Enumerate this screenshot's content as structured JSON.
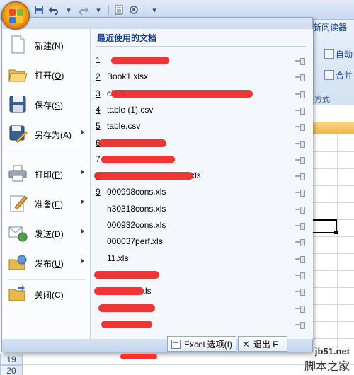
{
  "quick_access": {
    "items": [
      "save-icon",
      "undo-icon",
      "redo-icon",
      "print-preview-icon",
      "customize-icon"
    ]
  },
  "ribbon": {
    "tab_partial": "新阅读器",
    "autofill_partial": "自动",
    "merge_partial": "合并",
    "group_partial": "方式"
  },
  "grid": {
    "row_number": "19",
    "row_number_2": "20"
  },
  "menu": {
    "commands": [
      {
        "label": "新建",
        "hotkey": "N",
        "icon": "new-document-icon",
        "submenu": false
      },
      {
        "label": "打开",
        "hotkey": "O",
        "icon": "open-folder-icon",
        "submenu": false
      },
      {
        "label": "保存",
        "hotkey": "S",
        "icon": "save-disk-icon",
        "submenu": false
      },
      {
        "label": "另存为",
        "hotkey": "A",
        "icon": "save-as-icon",
        "submenu": true
      },
      {
        "label": "打印",
        "hotkey": "P",
        "icon": "printer-icon",
        "submenu": true
      },
      {
        "label": "准备",
        "hotkey": "E",
        "icon": "prepare-icon",
        "submenu": true
      },
      {
        "label": "发送",
        "hotkey": "D",
        "icon": "send-icon",
        "submenu": true
      },
      {
        "label": "发布",
        "hotkey": "U",
        "icon": "publish-icon",
        "submenu": true
      },
      {
        "label": "关闭",
        "hotkey": "C",
        "icon": "close-folder-icon",
        "submenu": false
      }
    ],
    "recent_title": "最近使用的文档",
    "recent_docs": [
      {
        "num": "1",
        "name": "",
        "redacted": true
      },
      {
        "num": "2",
        "name": "Book1.xlsx",
        "redacted": false
      },
      {
        "num": "3",
        "name": "ch09",
        "redacted": true
      },
      {
        "num": "4",
        "name": "table (1).csv",
        "redacted": false
      },
      {
        "num": "5",
        "name": "table.csv",
        "redacted": false
      },
      {
        "num": "6",
        "name": "",
        "redacted": true
      },
      {
        "num": "7",
        "name": "",
        "redacted": true
      },
      {
        "num": "8",
        "name": "xls",
        "redacted": true
      },
      {
        "num": "9",
        "name": "000998cons.xls",
        "redacted": false
      },
      {
        "num": "",
        "name": "h30318cons.xls",
        "redacted": false
      },
      {
        "num": "",
        "name": "000932cons.xls",
        "redacted": false
      },
      {
        "num": "",
        "name": "000037perf.xls",
        "redacted": false
      },
      {
        "num": "",
        "name": "11.xls",
        "redacted": false
      },
      {
        "num": "",
        "name": "",
        "redacted": true
      },
      {
        "num": "",
        "name": "xls",
        "redacted": true
      },
      {
        "num": "",
        "name": "",
        "redacted": true
      },
      {
        "num": "",
        "name": "",
        "redacted": true
      }
    ],
    "options_button": "Excel 选项(I)",
    "exit_button": "退出 E"
  },
  "watermark": {
    "url": "jb51.net",
    "site": "脚本之家"
  },
  "colors": {
    "menu_bg": "#dde8f5",
    "accent": "#15428b",
    "redaction": "#ee2a2a"
  }
}
